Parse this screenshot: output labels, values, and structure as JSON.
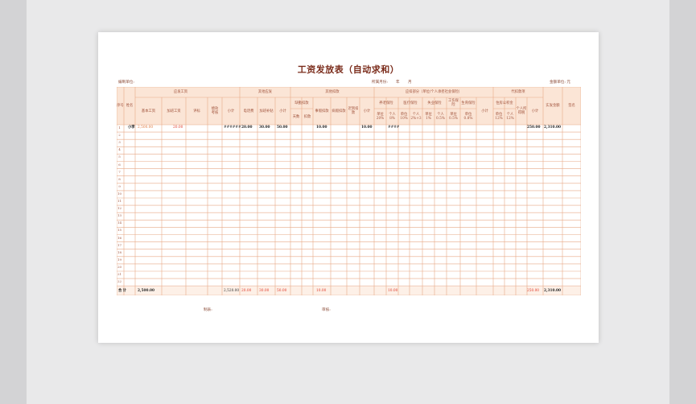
{
  "document": {
    "title": "工资发放表（自动求和）",
    "unit_label": "编制单位:",
    "period_label": "所属月份:",
    "year_label": "年",
    "month_label": "月",
    "currency_label": "金额单位: 元",
    "maker_label": "制表:",
    "reviewer_label": "审核:"
  },
  "headers": {
    "seq": "序号",
    "name": "姓名",
    "group_base": "应发工资",
    "base": "基本工资",
    "overtime": "加班工资",
    "evaluation": "评标",
    "performance": "绩效考核",
    "subtotal": "小计",
    "group_other_pay": "其他应发",
    "phone": "电话费",
    "overtime_allow": "加班补贴",
    "group_other_deduct": "其他扣款",
    "absence": "缺勤扣款",
    "days": "天数",
    "deduct": "扣款",
    "sick": "事假扣款",
    "illness": "病假扣款",
    "late": "迟到扣款",
    "group_insurance": "应扣部分（单位/个人承担社会保险）",
    "pension": "养老保险",
    "pension_company": "单位 20%",
    "pension_personal": "个人 8%",
    "medical": "医疗保险",
    "medical_company": "单位 10%",
    "medical_personal": "个人 2%+3",
    "unemployment": "失业保险",
    "unemp_company": "单位 1%",
    "unemp_personal": "个人 0.5%",
    "injury": "工伤保险",
    "injury_company": "单位 0.5%",
    "maternity": "生育保险",
    "maternity_company": "单位 0.8%",
    "group_withhold": "代扣款项",
    "housing_fund": "住房公积金",
    "hf_company": "单位 12%",
    "hf_personal": "个人 12%",
    "income_tax": "个人所得税",
    "net_pay": "实发金额",
    "signature": "签名"
  },
  "rows": {
    "first_row_no": "1",
    "first_row_name": "小李",
    "base": "2,500.00",
    "overtime": "20.00",
    "subtotal": "######",
    "phone": "20.00",
    "overtime_allow": "30.00",
    "other_subtotal": "50.00",
    "sick": "10.00",
    "deduct_subtotal": "10.00",
    "pension_personal": "####",
    "withhold_subtotal": "250.00",
    "net_pay": "2,310.00",
    "row_numbers": [
      "1",
      "2",
      "3",
      "4",
      "5",
      "6",
      "7",
      "8",
      "9",
      "10",
      "11",
      "12",
      "13",
      "14",
      "15",
      "16",
      "17",
      "18",
      "19",
      "20",
      "21",
      "22"
    ]
  },
  "totals": {
    "label": "合 计",
    "base": "2,500.00",
    "subtotal": "2,520.00",
    "phone": "20.00",
    "overtime_allow": "30.00",
    "other_subtotal": "50.00",
    "sick": "10.00",
    "insurance_subtotal": "10.00",
    "withhold_subtotal": "250.00",
    "net_pay": "2,310.00"
  },
  "colors": {
    "header_fill": "#fbe5d6",
    "grid_line": "#e8a987",
    "title": "#7a2b1a",
    "accent_red": "#e03a2a"
  }
}
